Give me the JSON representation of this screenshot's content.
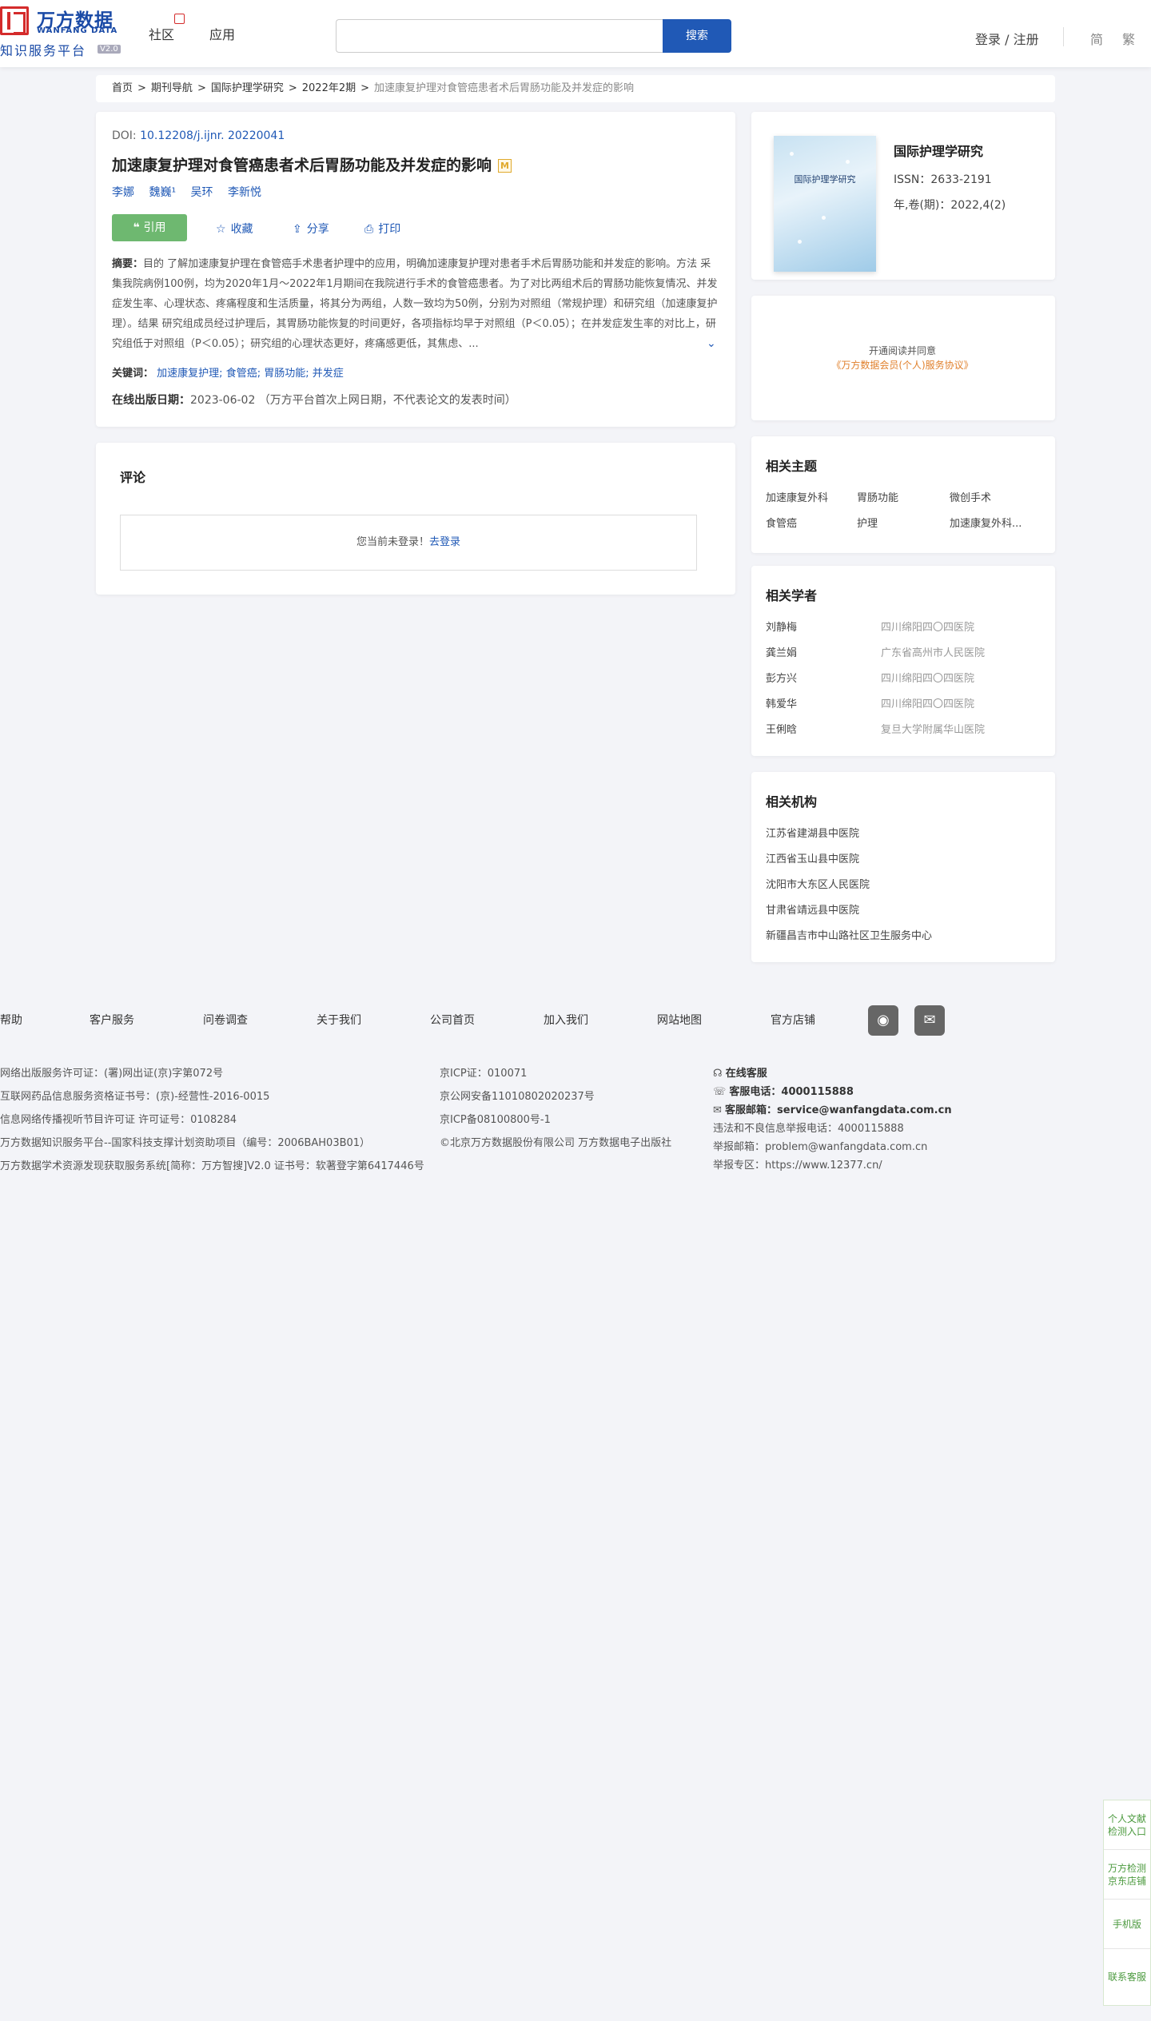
{
  "header": {
    "logo_cn": "万方数据",
    "logo_en": "WANFANG DATA",
    "logo_sub": "知识服务平台",
    "logo_version": "V2.0",
    "nav": [
      "社区",
      "应用"
    ],
    "search_placeholder": "",
    "search_button": "搜索",
    "login": "登录 / 注册",
    "lang_simplified": "简",
    "lang_traditional": "繁"
  },
  "breadcrumb": [
    "首页",
    "期刊导航",
    "国际护理学研究",
    "2022年2期",
    "加速康复护理对食管癌患者术后胃肠功能及并发症的影响"
  ],
  "article": {
    "doi_label": "DOI:",
    "doi": "10.12208/j.ijnr. 20220041",
    "title": "加速康复护理对食管癌患者术后胃肠功能及并发症的影响",
    "m_badge": "M",
    "authors": [
      "李娜",
      "魏巍¹",
      "吴环",
      "李新悦"
    ],
    "actions": {
      "cite": "引用",
      "favorite": "收藏",
      "share": "分享",
      "print": "打印"
    },
    "abstract_label": "摘要：",
    "abstract": "目的 了解加速康复护理在食管癌手术患者护理中的应用，明确加速康复护理对患者手术后胃肠功能和并发症的影响。方法 采集我院病例100例，均为2020年1月～2022年1月期间在我院进行手术的食管癌患者。为了对比两组术后的胃肠功能恢复情况、并发症发生率、心理状态、疼痛程度和生活质量，将其分为两组，人数一致均为50例，分别为对照组（常规护理）和研究组（加速康复护理）。结果 研究组成员经过护理后，其胃肠功能恢复的时间更好，各项指标均早于对照组（P＜0.05）；在并发症发生率的对比上，研究组低于对照组（P＜0.05）；研究组的心理状态更好，疼痛感更低，其焦虑、...",
    "keywords_label": "关键词：",
    "keywords": [
      "加速康复护理;",
      "食管癌;",
      "胃肠功能;",
      "并发症"
    ],
    "pubdate_label": "在线出版日期：",
    "pubdate": "2023-06-02 （万方平台首次上网日期，不代表论文的发表时间）"
  },
  "comment": {
    "title": "评论",
    "not_logged_in": "您当前未登录！",
    "login_link": "去登录"
  },
  "journal": {
    "cover_title": "国际护理学研究",
    "name": "国际护理学研究",
    "issn": "ISSN：2633-2191",
    "volume": "年,卷(期)：2022,4(2)"
  },
  "open_read": {
    "line1": "开通阅读并同意",
    "agreement": "《万方数据会员(个人)服务协议》"
  },
  "related_topics": {
    "title": "相关主题",
    "items": [
      "加速康复外科",
      "胃肠功能",
      "微创手术",
      "食管癌",
      "护理",
      "加速康复外科..."
    ]
  },
  "related_scholars": {
    "title": "相关学者",
    "items": [
      {
        "name": "刘静梅",
        "inst": "四川绵阳四〇四医院"
      },
      {
        "name": "龚兰娟",
        "inst": "广东省高州市人民医院"
      },
      {
        "name": "彭方兴",
        "inst": "四川绵阳四〇四医院"
      },
      {
        "name": "韩爱华",
        "inst": "四川绵阳四〇四医院"
      },
      {
        "name": "王俐晗",
        "inst": "复旦大学附属华山医院"
      }
    ]
  },
  "related_institutions": {
    "title": "相关机构",
    "items": [
      "江苏省建湖县中医院",
      "江西省玉山县中医院",
      "沈阳市大东区人民医院",
      "甘肃省靖远县中医院",
      "新疆昌吉市中山路社区卫生服务中心"
    ]
  },
  "footer": {
    "nav": [
      "帮助",
      "客户服务",
      "问卷调查",
      "关于我们",
      "公司首页",
      "加入我们",
      "网站地图",
      "官方店铺"
    ],
    "col1": [
      "网络出版服务许可证：(署)网出证(京)字第072号",
      "互联网药品信息服务资格证书号：(京)-经营性-2016-0015",
      "信息网络传播视听节目许可证 许可证号：0108284",
      "万方数据知识服务平台--国家科技支撑计划资助项目（编号：2006BAH03B01）",
      "万方数据学术资源发现获取服务系统[简称：万方智搜]V2.0 证书号：软著登字第6417446号"
    ],
    "col2": [
      "京ICP证：010071",
      "京公网安备11010802020237号",
      "京ICP备08100800号-1",
      "©北京万方数据股份有限公司 万方数据电子出版社"
    ],
    "col3": {
      "online_service": "在线客服",
      "phone_label": "客服电话：",
      "phone": "4000115888",
      "email_label": "客服邮箱：",
      "email": "service@wanfangdata.com.cn",
      "report_phone": "违法和不良信息举报电话：4000115888",
      "report_email": "举报邮箱：problem@wanfangdata.com.cn",
      "report_site": "举报专区：https://www.12377.cn/"
    }
  },
  "float_panel": [
    "个人文献检测入口",
    "万方检测京东店铺",
    "手机版",
    "联系客服"
  ]
}
